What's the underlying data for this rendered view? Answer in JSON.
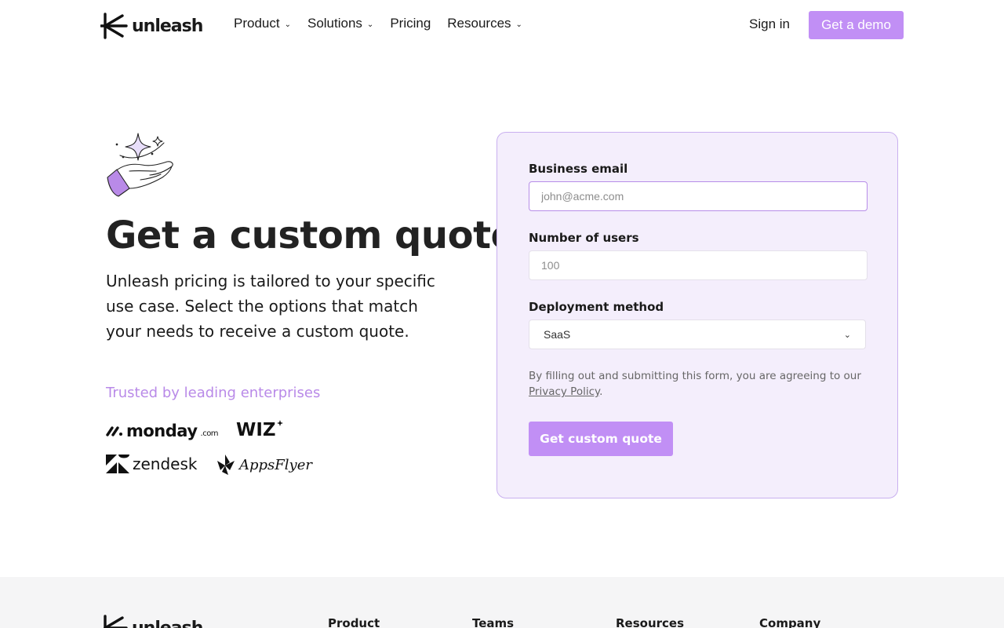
{
  "nav": {
    "brand": "unleash",
    "links": [
      {
        "label": "Product",
        "has_dropdown": true
      },
      {
        "label": "Solutions",
        "has_dropdown": true
      },
      {
        "label": "Pricing",
        "has_dropdown": false
      },
      {
        "label": "Resources",
        "has_dropdown": true
      }
    ],
    "sign_in": "Sign in",
    "demo_button": "Get a demo"
  },
  "hero": {
    "title": "Get a custom quote",
    "description": "Unleash pricing is tailored to your specific use case. Select the options that match your needs to receive a custom quote.",
    "trusted_label": "Trusted by leading enterprises",
    "brands": {
      "monday": "monday",
      "monday_suffix": ".com",
      "wiz": "WIZ",
      "zendesk": "zendesk",
      "appsflyer": "AppsFlyer"
    }
  },
  "form": {
    "email_label": "Business email",
    "email_placeholder": "john@acme.com",
    "users_label": "Number of users",
    "users_placeholder": "100",
    "deployment_label": "Deployment method",
    "deployment_selected": "SaaS",
    "consent_text": "By filling out and submitting this form, you are agreeing to our",
    "privacy_link": "Privacy Policy",
    "consent_end": ".",
    "submit_label": "Get custom quote"
  },
  "footer": {
    "brand": "unleash",
    "columns": [
      "Product",
      "Teams",
      "Resources",
      "Company"
    ]
  },
  "colors": {
    "accent": "#c18ff5",
    "card_bg": "#f4eefc",
    "trusted_text": "#b98ae8"
  }
}
